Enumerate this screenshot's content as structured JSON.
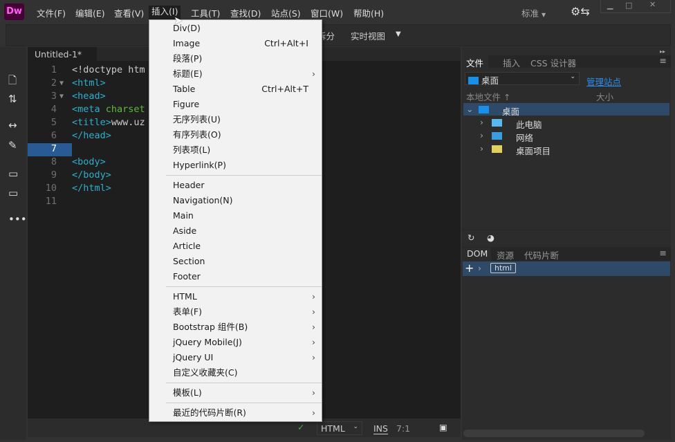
{
  "app": {
    "logo": "Dw",
    "workspace": "标准"
  },
  "menubar": [
    "文件(F)",
    "编辑(E)",
    "查看(V)",
    "插入(I)",
    "工具(T)",
    "查找(D)",
    "站点(S)",
    "窗口(W)",
    "帮助(H)"
  ],
  "toolbar": {
    "split": "拆分",
    "live_view": "实时视图"
  },
  "document": {
    "tab": "Untitled-1*",
    "close": "×"
  },
  "code_lines": [
    {
      "n": "1",
      "parts": [
        [
          "txt",
          "<!doctype htm"
        ]
      ]
    },
    {
      "n": "2",
      "fold": "▼",
      "parts": [
        [
          "tag",
          "<html>"
        ]
      ]
    },
    {
      "n": "3",
      "fold": "▼",
      "parts": [
        [
          "tag",
          "<head>"
        ]
      ]
    },
    {
      "n": "4",
      "parts": [
        [
          "tag",
          "<meta "
        ],
        [
          "attr",
          "charset"
        ]
      ]
    },
    {
      "n": "5",
      "parts": [
        [
          "tag",
          "<title>"
        ],
        [
          "txt",
          "www.uz"
        ]
      ]
    },
    {
      "n": "6",
      "parts": [
        [
          "tag",
          "</head>"
        ]
      ]
    },
    {
      "n": "7",
      "parts": []
    },
    {
      "n": "8",
      "parts": [
        [
          "tag",
          "<body>"
        ]
      ]
    },
    {
      "n": "9",
      "parts": [
        [
          "tag",
          "</body>"
        ]
      ]
    },
    {
      "n": "10",
      "parts": [
        [
          "tag",
          "</html>"
        ]
      ]
    },
    {
      "n": "11",
      "parts": []
    }
  ],
  "current_line": "7",
  "insert_menu": [
    {
      "label": "Div(D)"
    },
    {
      "label": "Image",
      "shortcut": "Ctrl+Alt+I"
    },
    {
      "label": "段落(P)"
    },
    {
      "label": "标题(E)",
      "submenu": true
    },
    {
      "label": "Table",
      "shortcut": "Ctrl+Alt+T"
    },
    {
      "label": "Figure"
    },
    {
      "label": "无序列表(U)"
    },
    {
      "label": "有序列表(O)"
    },
    {
      "label": "列表项(L)"
    },
    {
      "label": "Hyperlink(P)"
    },
    {
      "sep": true
    },
    {
      "label": "Header"
    },
    {
      "label": "Navigation(N)"
    },
    {
      "label": "Main"
    },
    {
      "label": "Aside"
    },
    {
      "label": "Article"
    },
    {
      "label": "Section"
    },
    {
      "label": "Footer"
    },
    {
      "sep": true
    },
    {
      "label": "HTML",
      "submenu": true
    },
    {
      "label": "表单(F)",
      "submenu": true
    },
    {
      "label": "Bootstrap 组件(B)",
      "submenu": true
    },
    {
      "label": "jQuery Mobile(J)",
      "submenu": true
    },
    {
      "label": "jQuery UI",
      "submenu": true
    },
    {
      "label": "自定义收藏夹(C)"
    },
    {
      "sep": true
    },
    {
      "label": "模板(L)",
      "submenu": true
    },
    {
      "sep": true
    },
    {
      "label": "最近的代码片断(R)",
      "submenu": true
    }
  ],
  "status": {
    "language": "HTML",
    "mode": "INS",
    "position": "7:1"
  },
  "files_panel": {
    "tabs": [
      "文件",
      "插入",
      "CSS 设计器"
    ],
    "site": "桌面",
    "manage": "管理站点",
    "col_local": "本地文件",
    "col_size": "大小",
    "tree": [
      {
        "label": "桌面",
        "level": 0,
        "expanded": true,
        "icon": "desktop-icon"
      },
      {
        "label": "此电脑",
        "level": 1,
        "icon": "computer-icon"
      },
      {
        "label": "网络",
        "level": 1,
        "icon": "network-icon"
      },
      {
        "label": "桌面项目",
        "level": 1,
        "icon": "folder-icon"
      }
    ]
  },
  "dom_panel": {
    "tabs": [
      "DOM",
      "资源",
      "代码片断"
    ],
    "node": "html"
  },
  "colors": {
    "accent": "#2a5a93",
    "link": "#2d8ceb",
    "tag": "#2ab1cf",
    "attr": "#5fba3f"
  }
}
